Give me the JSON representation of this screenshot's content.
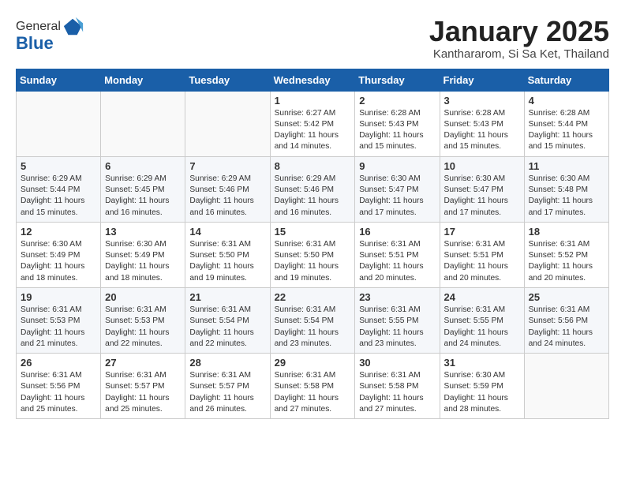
{
  "header": {
    "logo_line1": "General",
    "logo_line2": "Blue",
    "title": "January 2025",
    "subtitle": "Kanthararom, Si Sa Ket, Thailand"
  },
  "weekdays": [
    "Sunday",
    "Monday",
    "Tuesday",
    "Wednesday",
    "Thursday",
    "Friday",
    "Saturday"
  ],
  "weeks": [
    [
      {
        "day": "",
        "info": ""
      },
      {
        "day": "",
        "info": ""
      },
      {
        "day": "",
        "info": ""
      },
      {
        "day": "1",
        "info": "Sunrise: 6:27 AM\nSunset: 5:42 PM\nDaylight: 11 hours\nand 14 minutes."
      },
      {
        "day": "2",
        "info": "Sunrise: 6:28 AM\nSunset: 5:43 PM\nDaylight: 11 hours\nand 15 minutes."
      },
      {
        "day": "3",
        "info": "Sunrise: 6:28 AM\nSunset: 5:43 PM\nDaylight: 11 hours\nand 15 minutes."
      },
      {
        "day": "4",
        "info": "Sunrise: 6:28 AM\nSunset: 5:44 PM\nDaylight: 11 hours\nand 15 minutes."
      }
    ],
    [
      {
        "day": "5",
        "info": "Sunrise: 6:29 AM\nSunset: 5:44 PM\nDaylight: 11 hours\nand 15 minutes."
      },
      {
        "day": "6",
        "info": "Sunrise: 6:29 AM\nSunset: 5:45 PM\nDaylight: 11 hours\nand 16 minutes."
      },
      {
        "day": "7",
        "info": "Sunrise: 6:29 AM\nSunset: 5:46 PM\nDaylight: 11 hours\nand 16 minutes."
      },
      {
        "day": "8",
        "info": "Sunrise: 6:29 AM\nSunset: 5:46 PM\nDaylight: 11 hours\nand 16 minutes."
      },
      {
        "day": "9",
        "info": "Sunrise: 6:30 AM\nSunset: 5:47 PM\nDaylight: 11 hours\nand 17 minutes."
      },
      {
        "day": "10",
        "info": "Sunrise: 6:30 AM\nSunset: 5:47 PM\nDaylight: 11 hours\nand 17 minutes."
      },
      {
        "day": "11",
        "info": "Sunrise: 6:30 AM\nSunset: 5:48 PM\nDaylight: 11 hours\nand 17 minutes."
      }
    ],
    [
      {
        "day": "12",
        "info": "Sunrise: 6:30 AM\nSunset: 5:49 PM\nDaylight: 11 hours\nand 18 minutes."
      },
      {
        "day": "13",
        "info": "Sunrise: 6:30 AM\nSunset: 5:49 PM\nDaylight: 11 hours\nand 18 minutes."
      },
      {
        "day": "14",
        "info": "Sunrise: 6:31 AM\nSunset: 5:50 PM\nDaylight: 11 hours\nand 19 minutes."
      },
      {
        "day": "15",
        "info": "Sunrise: 6:31 AM\nSunset: 5:50 PM\nDaylight: 11 hours\nand 19 minutes."
      },
      {
        "day": "16",
        "info": "Sunrise: 6:31 AM\nSunset: 5:51 PM\nDaylight: 11 hours\nand 20 minutes."
      },
      {
        "day": "17",
        "info": "Sunrise: 6:31 AM\nSunset: 5:51 PM\nDaylight: 11 hours\nand 20 minutes."
      },
      {
        "day": "18",
        "info": "Sunrise: 6:31 AM\nSunset: 5:52 PM\nDaylight: 11 hours\nand 20 minutes."
      }
    ],
    [
      {
        "day": "19",
        "info": "Sunrise: 6:31 AM\nSunset: 5:53 PM\nDaylight: 11 hours\nand 21 minutes."
      },
      {
        "day": "20",
        "info": "Sunrise: 6:31 AM\nSunset: 5:53 PM\nDaylight: 11 hours\nand 22 minutes."
      },
      {
        "day": "21",
        "info": "Sunrise: 6:31 AM\nSunset: 5:54 PM\nDaylight: 11 hours\nand 22 minutes."
      },
      {
        "day": "22",
        "info": "Sunrise: 6:31 AM\nSunset: 5:54 PM\nDaylight: 11 hours\nand 23 minutes."
      },
      {
        "day": "23",
        "info": "Sunrise: 6:31 AM\nSunset: 5:55 PM\nDaylight: 11 hours\nand 23 minutes."
      },
      {
        "day": "24",
        "info": "Sunrise: 6:31 AM\nSunset: 5:55 PM\nDaylight: 11 hours\nand 24 minutes."
      },
      {
        "day": "25",
        "info": "Sunrise: 6:31 AM\nSunset: 5:56 PM\nDaylight: 11 hours\nand 24 minutes."
      }
    ],
    [
      {
        "day": "26",
        "info": "Sunrise: 6:31 AM\nSunset: 5:56 PM\nDaylight: 11 hours\nand 25 minutes."
      },
      {
        "day": "27",
        "info": "Sunrise: 6:31 AM\nSunset: 5:57 PM\nDaylight: 11 hours\nand 25 minutes."
      },
      {
        "day": "28",
        "info": "Sunrise: 6:31 AM\nSunset: 5:57 PM\nDaylight: 11 hours\nand 26 minutes."
      },
      {
        "day": "29",
        "info": "Sunrise: 6:31 AM\nSunset: 5:58 PM\nDaylight: 11 hours\nand 27 minutes."
      },
      {
        "day": "30",
        "info": "Sunrise: 6:31 AM\nSunset: 5:58 PM\nDaylight: 11 hours\nand 27 minutes."
      },
      {
        "day": "31",
        "info": "Sunrise: 6:30 AM\nSunset: 5:59 PM\nDaylight: 11 hours\nand 28 minutes."
      },
      {
        "day": "",
        "info": ""
      }
    ]
  ]
}
